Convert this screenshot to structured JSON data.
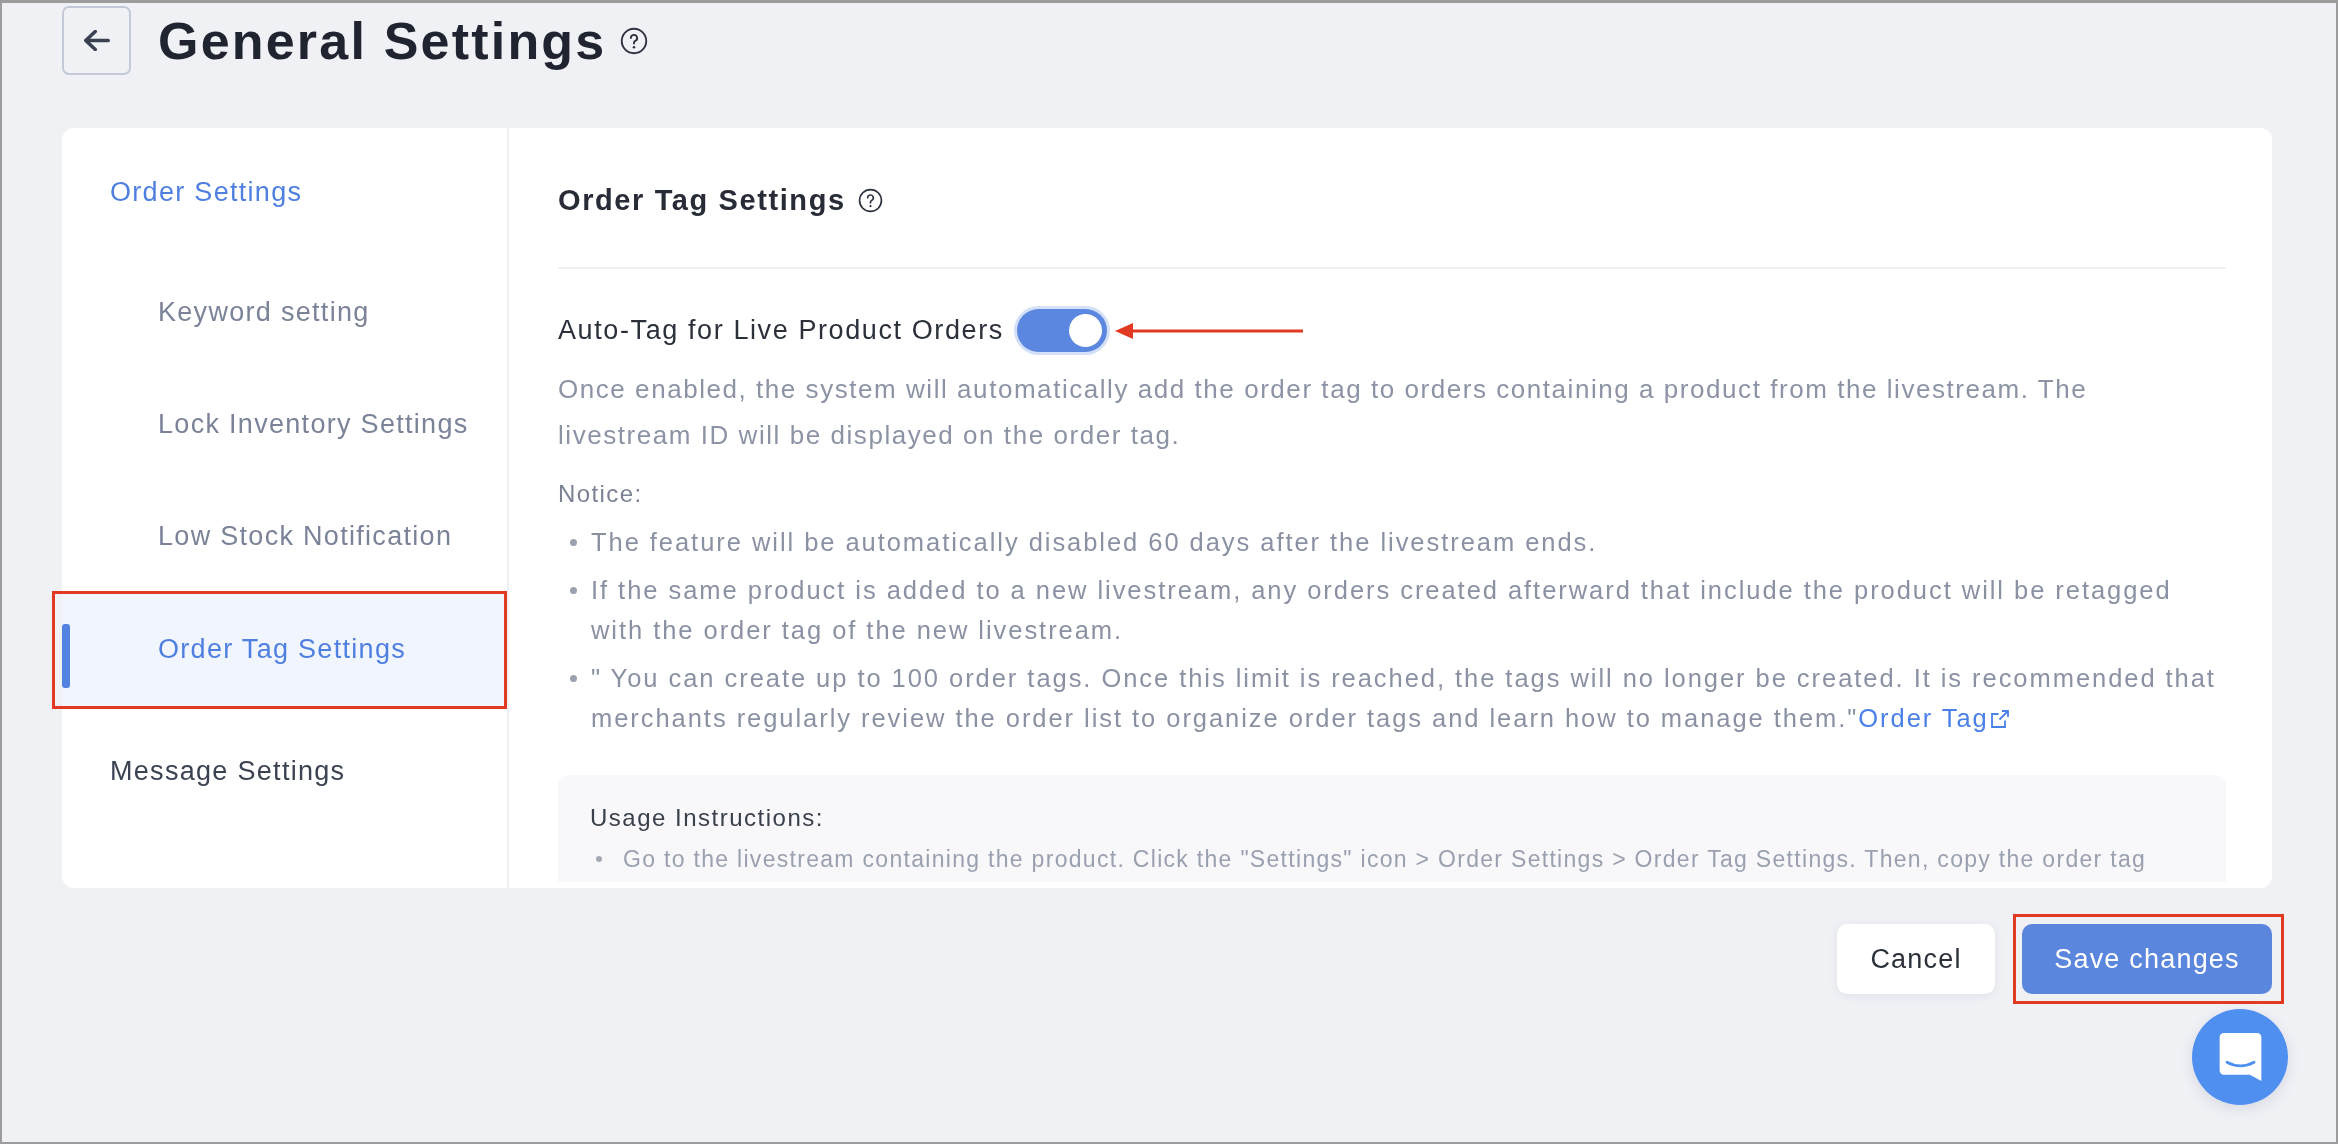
{
  "header": {
    "title": "General Settings"
  },
  "sidebar": {
    "groups": [
      {
        "label": "Order Settings",
        "active": true,
        "children": [
          {
            "label": "Keyword setting",
            "selected": false
          },
          {
            "label": "Lock Inventory Settings",
            "selected": false
          },
          {
            "label": "Low Stock Notification",
            "selected": false
          },
          {
            "label": "Order Tag Settings",
            "selected": true
          }
        ]
      },
      {
        "label": "Message Settings",
        "active": false
      }
    ]
  },
  "section": {
    "title": "Order Tag Settings",
    "auto_tag": {
      "label": "Auto-Tag for Live Product Orders",
      "on": true,
      "description": "Once enabled, the system will automatically add the order tag to orders containing a product from the livestream. The livestream ID will be displayed on the order tag."
    },
    "notice": {
      "title": "Notice:",
      "items": [
        {
          "text": "The feature will be automatically disabled 60 days after the livestream ends."
        },
        {
          "text": "If the same product is added to a new livestream, any orders created afterward that include the product will be retagged with the order tag of the new livestream."
        },
        {
          "text": "\" You can create up to 100 order tags. Once this limit is reached, the tags will no longer be created. It is recommended that merchants regularly review the order list to organize order tags and learn how to manage them.\"",
          "link": "Order Tag"
        }
      ]
    },
    "usage": {
      "title": "Usage Instructions:",
      "items": [
        "Go to the livestream containing the product. Click the \"Settings\" icon > Order Settings > Order Tag Settings. Then, copy the order tag"
      ]
    }
  },
  "buttons": [
    {
      "label": "Cancel",
      "kind": "secondary"
    },
    {
      "label": "Save changes",
      "kind": "primary"
    }
  ]
}
